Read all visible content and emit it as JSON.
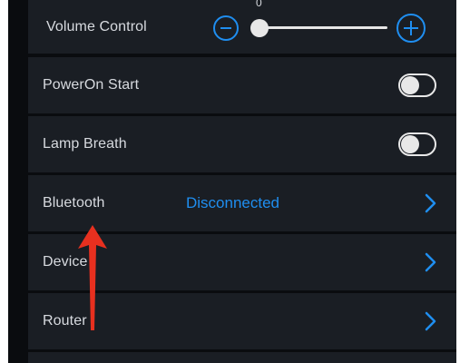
{
  "settings": {
    "volume": {
      "label": "Volume Control",
      "value": "0",
      "level": 0
    },
    "power_on_start": {
      "label": "PowerOn Start",
      "enabled": false
    },
    "lamp_breath": {
      "label": "Lamp Breath",
      "enabled": false
    },
    "bluetooth": {
      "label": "Bluetooth",
      "status": "Disconnected"
    },
    "device": {
      "label": "Device"
    },
    "router": {
      "label": "Router"
    }
  },
  "colors": {
    "accent": "#1f8ef0",
    "row_bg": "#1a1e24",
    "background": "#0a0c0f",
    "annotation_arrow": "#e8301f"
  },
  "icons": {
    "minus": "minus-circle-icon",
    "plus": "plus-circle-icon",
    "chevron": "chevron-right-icon"
  }
}
